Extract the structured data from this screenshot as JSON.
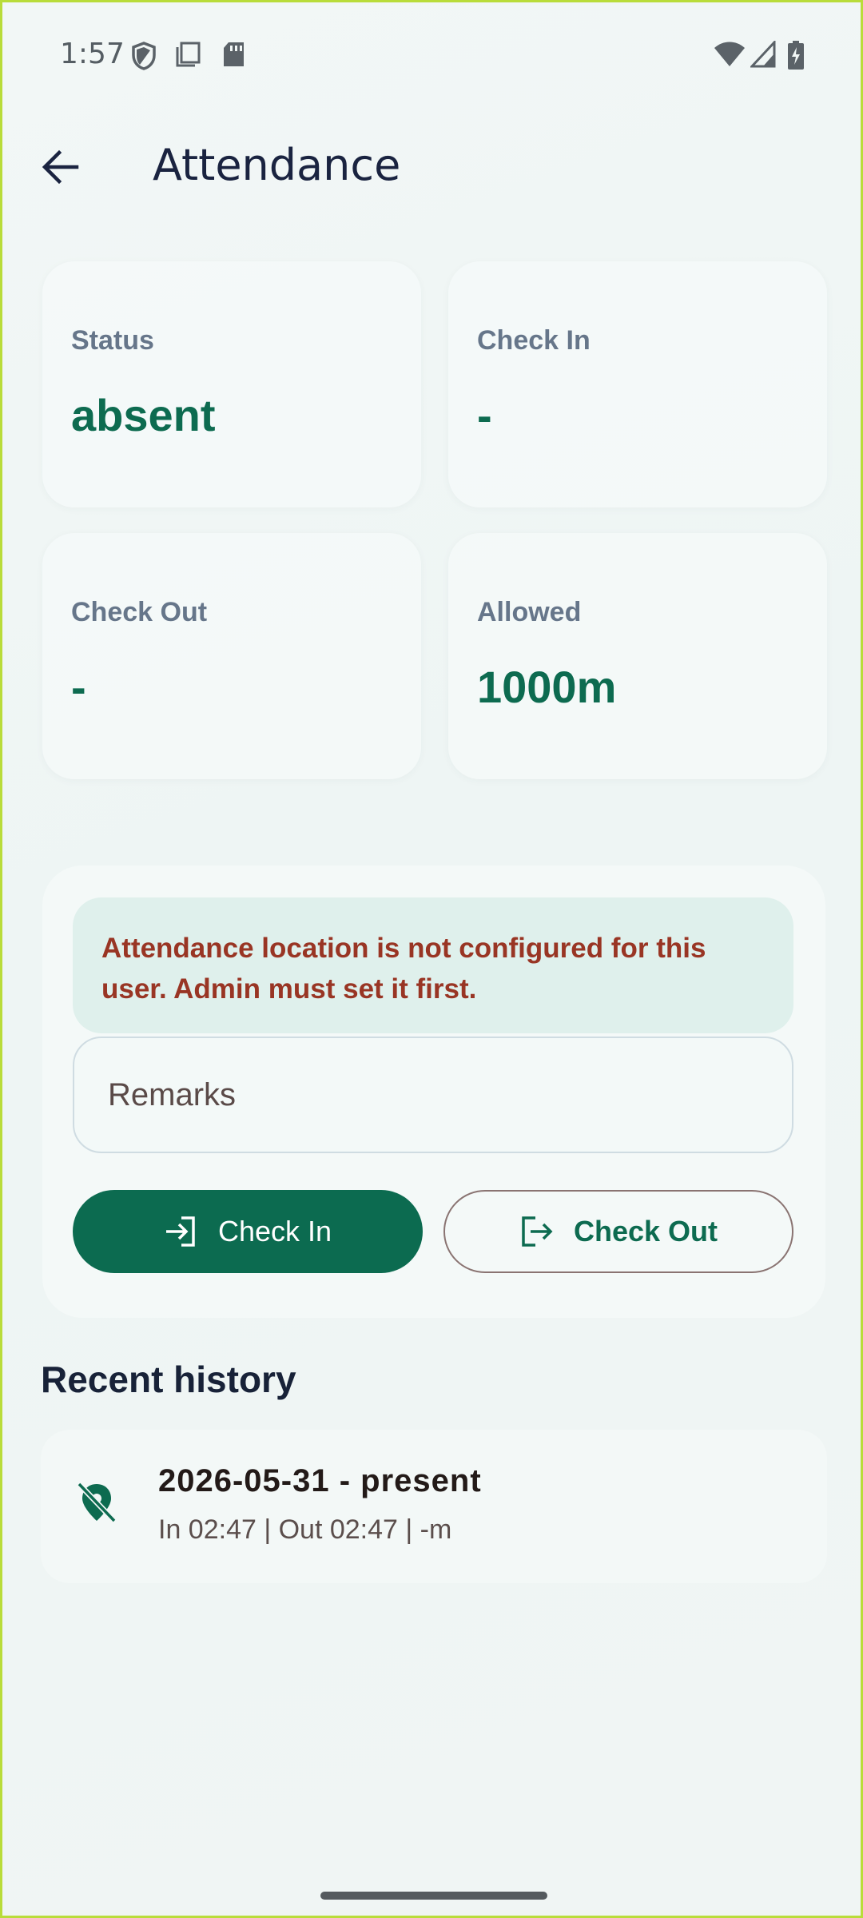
{
  "status_bar": {
    "time": "1:57",
    "icons": [
      "shield-icon",
      "clipboard-icon",
      "sd-card-icon",
      "wifi-icon",
      "signal-icon",
      "battery-charging-icon"
    ]
  },
  "app_bar": {
    "back_icon": "arrow-back-icon",
    "title": "Attendance"
  },
  "cards": {
    "status": {
      "label": "Status",
      "value": "absent"
    },
    "check_in": {
      "label": "Check In",
      "value": "-"
    },
    "check_out": {
      "label": "Check Out",
      "value": "-"
    },
    "allowed": {
      "label": "Allowed",
      "value": "1000m"
    }
  },
  "panel": {
    "alert": "Attendance location is not configured for this user. Admin must set it first.",
    "remarks_placeholder": "Remarks",
    "check_in_label": "Check In",
    "check_out_label": "Check Out",
    "check_in_icon": "login-icon",
    "check_out_icon": "logout-icon"
  },
  "history": {
    "title": "Recent history",
    "items": [
      {
        "icon": "location-off-icon",
        "title": "2026-05-31 - present",
        "subtitle": "In 02:47 | Out 02:47 | -m"
      }
    ]
  },
  "colors": {
    "accent": "#0c6b50",
    "alert_text": "#993524",
    "alert_bg": "#dff0ec",
    "screen_border": "#b9dc3a"
  }
}
